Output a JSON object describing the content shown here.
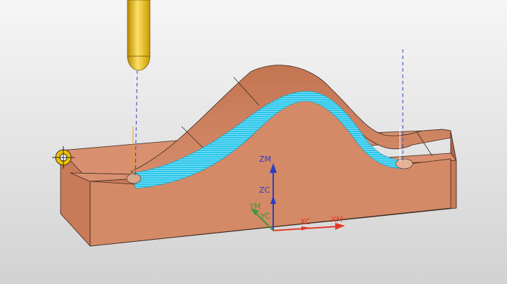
{
  "viewport": {
    "background_top": "#f6f6f6",
    "background_bottom": "#d2d2d2"
  },
  "part": {
    "top_color": "#d99070",
    "side_color": "#c97a58",
    "dark_color": "#b06545",
    "toolpath_color": "#2cc6ea"
  },
  "tool": {
    "shank_color": "#e6b800",
    "path_color": "#2a3cc8"
  },
  "axes": {
    "zm_label": "ZM",
    "zc_label": "ZC",
    "ym_label": "YM",
    "yc_label": "YC",
    "xc_label": "XC",
    "xm_label": "XM",
    "z_color": "#2a3cc8",
    "x_color": "#e23a2a",
    "y_color": "#3a9a3a"
  }
}
